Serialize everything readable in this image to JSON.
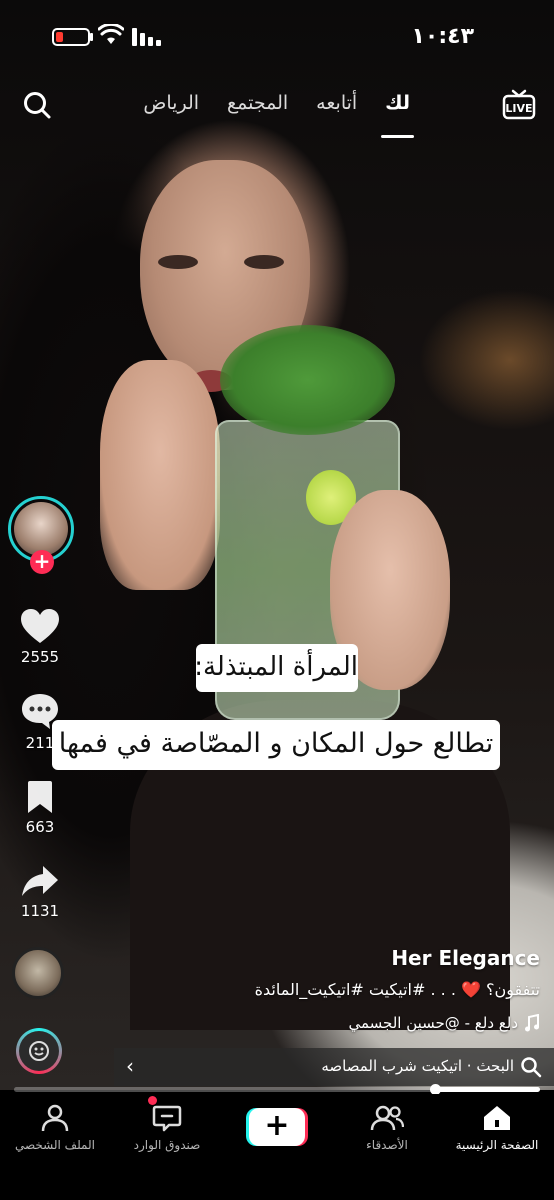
{
  "status_bar": {
    "time": "١٠:٤٣"
  },
  "top_nav": {
    "tabs": [
      {
        "label": "لك",
        "active": true
      },
      {
        "label": "أتابعه",
        "active": false
      },
      {
        "label": "المجتمع",
        "active": false
      },
      {
        "label": "الرياض",
        "active": false
      }
    ],
    "live_label": "LIVE",
    "search_icon": "search-icon"
  },
  "rail": {
    "likes": "2555",
    "comments": "211",
    "saves": "663",
    "shares": "1131"
  },
  "captions": {
    "line1": "المرأة المبتذلة:",
    "line2": "تطالع حول المكان و المصّاصة في فمها"
  },
  "post": {
    "author": "Her Elegance",
    "description_prefix": "تتفقون؟",
    "description_suffix": ". . . #اتيكيت #اتيكيت_المائدة",
    "heart_emoji": "❤️",
    "music": "دلع دلع - @حسين الجسمي"
  },
  "search_suggestion": {
    "label": "البحث · اتيكيت شرب المصاصه"
  },
  "progress": {
    "fraction": 0.2
  },
  "bottom_nav": {
    "home": "الصفحة الرئيسية",
    "friends": "الأصدقاء",
    "inbox": "صندوق الوارد",
    "profile": "الملف الشخصي"
  },
  "colors": {
    "accent_red": "#fe2c55",
    "accent_cyan": "#25f4ee"
  }
}
